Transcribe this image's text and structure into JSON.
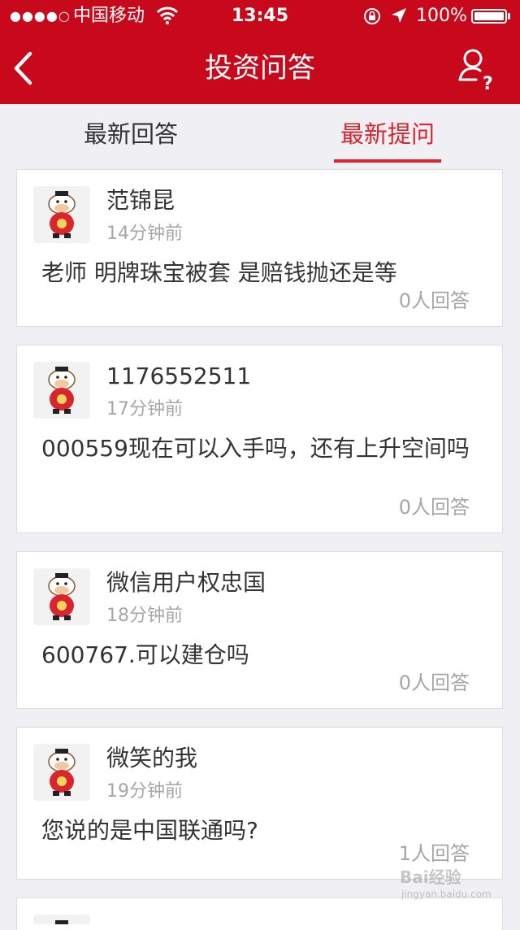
{
  "status_bar": {
    "carrier": "中国移动",
    "time": "13:45",
    "battery": "100%"
  },
  "nav": {
    "title": "投资问答"
  },
  "tabs": [
    {
      "label": "最新回答",
      "active": false
    },
    {
      "label": "最新提问",
      "active": true
    }
  ],
  "questions": [
    {
      "name": "范锦昆",
      "time": "14分钟前",
      "text": "老师 明牌珠宝被套 是赔钱抛还是等",
      "answers": "0人回答"
    },
    {
      "name": "1176552511",
      "time": "17分钟前",
      "text": "000559现在可以入手吗，还有上升空间吗",
      "answers": "0人回答"
    },
    {
      "name": "微信用户权忠国",
      "time": "18分钟前",
      "text": "600767.可以建仓吗",
      "answers": "0人回答"
    },
    {
      "name": "微笑的我",
      "time": "19分钟前",
      "text": "您说的是中国联通吗?",
      "answers": "1人回答"
    }
  ],
  "watermark": {
    "brand": "Bai经验",
    "url": "jingyan.baidu.com"
  },
  "colors": {
    "header": "#c8081b",
    "active_tab": "#d9252e",
    "background": "#efeff4"
  }
}
